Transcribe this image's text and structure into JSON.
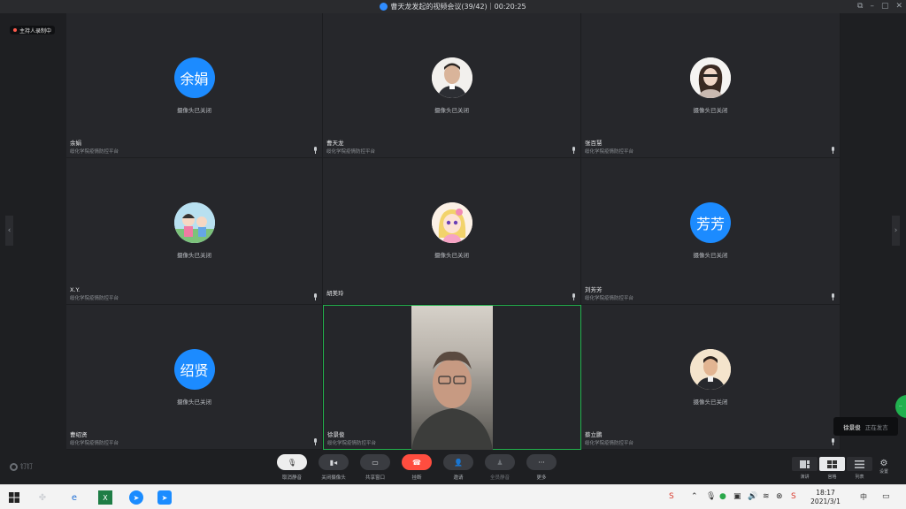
{
  "window": {
    "title": "曹天龙发起的视频会议(39/42)｜00:20:25",
    "controls": [
      "⧉",
      "–",
      "▢",
      "✕"
    ]
  },
  "recording": {
    "label": "主持人录制中"
  },
  "participants": [
    {
      "name": "余娟",
      "org": "绥化学院疫情防控平台",
      "avatar_type": "text",
      "avatar_text": "余娟",
      "camera_status": "摄像头已关闭"
    },
    {
      "name": "曹天龙",
      "org": "绥化学院疫情防控平台",
      "avatar_type": "photo-male",
      "avatar_text": "",
      "camera_status": "摄像头已关闭"
    },
    {
      "name": "张百慧",
      "org": "绥化学院疫情防控平台",
      "avatar_type": "photo-female",
      "avatar_text": "",
      "camera_status": "摄像头已关闭"
    },
    {
      "name": "X.Y.",
      "org": "绥化学院疫情防控平台",
      "avatar_type": "cartoon-scene",
      "avatar_text": "",
      "camera_status": "摄像头已关闭"
    },
    {
      "name": "胡美玲",
      "org": "",
      "avatar_type": "cartoon-girl",
      "avatar_text": "",
      "camera_status": "摄像头已关闭"
    },
    {
      "name": "刘芳芳",
      "org": "绥化学院疫情防控平台",
      "avatar_type": "text",
      "avatar_text": "芳芳",
      "camera_status": "摄像头已关闭"
    },
    {
      "name": "曹绍贤",
      "org": "绥化学院疫情防控平台",
      "avatar_type": "text",
      "avatar_text": "绍贤",
      "camera_status": "摄像头已关闭"
    },
    {
      "name": "徐景俊",
      "org": "绥化学院疫情防控平台",
      "avatar_type": "video",
      "avatar_text": "",
      "camera_status": ""
    },
    {
      "name": "蔡立鹏",
      "org": "绥化学院疫情防控平台",
      "avatar_type": "photo-male-2",
      "avatar_text": "",
      "camera_status": "摄像头已关闭"
    }
  ],
  "speaking": {
    "name": "徐景俊",
    "status": "正在发言"
  },
  "toolbar": {
    "brand": "钉钉",
    "buttons": [
      {
        "label": "取消静音",
        "icon": "mic-muted-icon"
      },
      {
        "label": "关闭摄像头",
        "icon": "camera-icon"
      },
      {
        "label": "共享窗口",
        "icon": "screen-share-icon"
      },
      {
        "label": "挂断",
        "icon": "hangup-icon"
      },
      {
        "label": "邀请",
        "icon": "invite-icon"
      },
      {
        "label": "全员静音",
        "icon": "mute-all-icon"
      },
      {
        "label": "更多",
        "icon": "more-icon"
      }
    ],
    "layouts": [
      {
        "label": "演讲",
        "icon": "speaker-layout-icon"
      },
      {
        "label": "宫格",
        "icon": "grid-layout-icon",
        "selected": true
      },
      {
        "label": "列表",
        "icon": "list-layout-icon"
      }
    ],
    "settings_label": "设置"
  },
  "taskbar": {
    "time": "18:17",
    "date": "2021/3/1",
    "ime": "中"
  }
}
